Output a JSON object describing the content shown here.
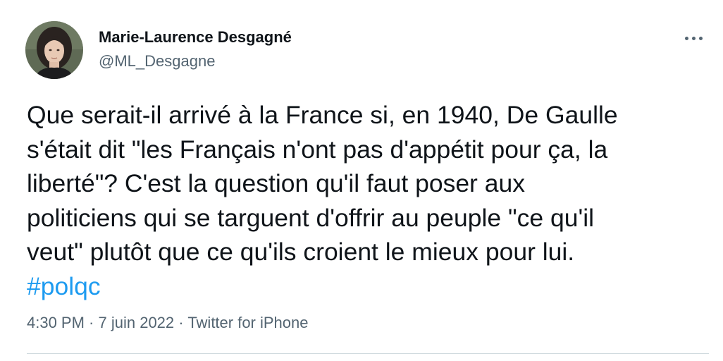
{
  "author": {
    "name": "Marie-Laurence Desgagné",
    "handle": "@ML_Desgagne"
  },
  "more_icon": "more-horizontal-icon",
  "tweet": {
    "lines": [
      "Que serait-il arrivé à la France si, en 1940, De Gaulle",
      "s'était dit \"les Français n'ont pas d'appétit pour ça, la",
      "liberté\"? C'est la question qu'il faut poser aux",
      "politiciens qui se targuent d'offrir au peuple \"ce qu'il",
      "veut\" plutôt que ce qu'ils croient le mieux pour lui."
    ],
    "hashtag": "#polqc"
  },
  "meta": {
    "time": "4:30 PM",
    "date": "7 juin 2022",
    "separator": " · ",
    "source": "Twitter for iPhone"
  },
  "colors": {
    "text": "#0f1419",
    "secondary": "#536471",
    "link": "#1d9bf0",
    "divider": "#cfd9de"
  }
}
